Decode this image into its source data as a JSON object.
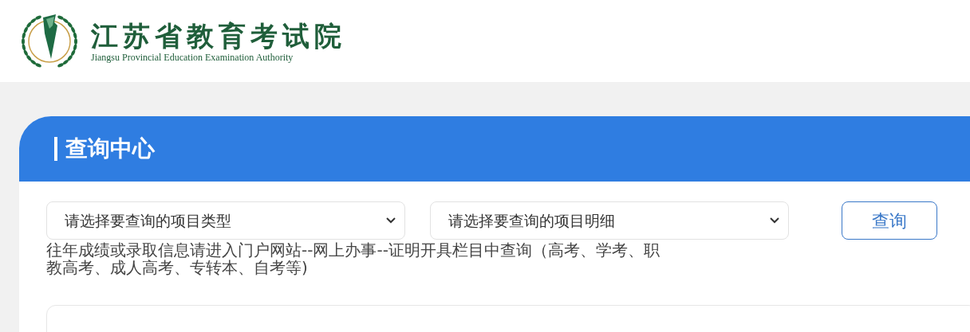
{
  "header": {
    "title": "江苏省教育考试院",
    "subtitle": "Jiangsu Provincial Education Examination Authority"
  },
  "panel": {
    "title": "查询中心",
    "selects": [
      {
        "placeholder": "请选择要查询的项目类型"
      },
      {
        "placeholder": "请选择要查询的项目明细"
      }
    ],
    "button": "查询",
    "note": "往年成绩或录取信息请进入门户网站--网上办事--证明开具栏目中查询（高考、学考、职教高考、成人高考、专转本、自考等)"
  }
}
